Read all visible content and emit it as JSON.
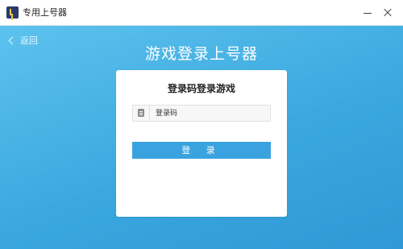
{
  "window": {
    "title": "专用上号器"
  },
  "nav": {
    "back_label": "返回"
  },
  "page": {
    "title": "游戏登录上号器"
  },
  "card": {
    "title": "登录码登录游戏",
    "code_input": {
      "placeholder": "登录码",
      "value": ""
    },
    "login_label": "登 录"
  },
  "colors": {
    "background": "#3aa8df",
    "button": "#3aa3df",
    "card": "#ffffff"
  }
}
